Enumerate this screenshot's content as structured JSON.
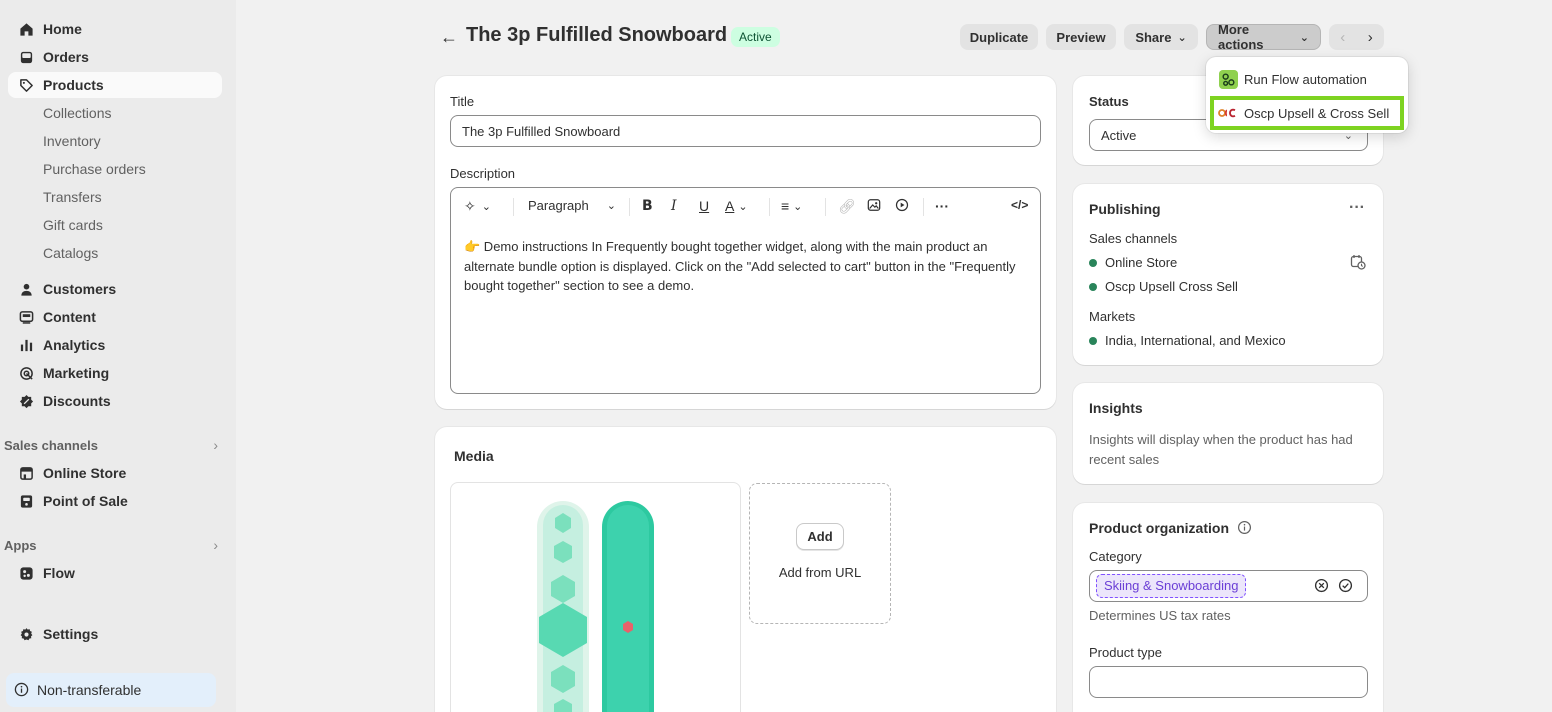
{
  "sidebar": {
    "main_items": [
      {
        "label": "Home",
        "icon": "home-icon"
      },
      {
        "label": "Orders",
        "icon": "orders-icon"
      },
      {
        "label": "Products",
        "icon": "tag-icon"
      }
    ],
    "product_subitems": [
      "Collections",
      "Inventory",
      "Purchase orders",
      "Transfers",
      "Gift cards",
      "Catalogs"
    ],
    "other_items": [
      {
        "label": "Customers",
        "icon": "person-icon"
      },
      {
        "label": "Content",
        "icon": "content-icon"
      },
      {
        "label": "Analytics",
        "icon": "chart-bar-icon"
      },
      {
        "label": "Marketing",
        "icon": "target-icon"
      },
      {
        "label": "Discounts",
        "icon": "discount-icon"
      }
    ],
    "sales_channels_label": "Sales channels",
    "sales_channels": [
      {
        "label": "Online Store",
        "icon": "store-icon"
      },
      {
        "label": "Point of Sale",
        "icon": "pos-icon"
      }
    ],
    "apps_label": "Apps",
    "apps": [
      {
        "label": "Flow",
        "icon": "flow-icon"
      }
    ],
    "settings_label": "Settings",
    "footer_label": "Non-transferable"
  },
  "header": {
    "title": "The 3p Fulfilled Snowboard",
    "status_badge": "Active",
    "buttons": {
      "duplicate": "Duplicate",
      "preview": "Preview",
      "share": "Share",
      "more_actions": "More actions"
    }
  },
  "more_actions_menu": {
    "items": [
      {
        "label": "Run Flow automation",
        "icon": "flow-app-icon"
      },
      {
        "label": "Oscp Upsell & Cross Sell",
        "icon": "oscp-app-icon"
      }
    ]
  },
  "main": {
    "title_label": "Title",
    "title_value": "The 3p Fulfilled Snowboard",
    "description_label": "Description",
    "toolbar": {
      "paragraph": "Paragraph"
    },
    "description_emoji": "👉",
    "description_text": " Demo instructions In Frequently bought together widget, along with the main product an alternate bundle option is displayed. Click on the \"Add selected to cart\" button in the \"Frequently bought together\" section to see a demo.",
    "media_title": "Media",
    "media_add_button": "Add",
    "media_add_from_url": "Add from URL"
  },
  "status_card": {
    "title": "Status",
    "value": "Active"
  },
  "publishing": {
    "title": "Publishing",
    "sales_channels_label": "Sales channels",
    "channels": [
      "Online Store",
      "Oscp Upsell Cross Sell"
    ],
    "markets_label": "Markets",
    "markets": "India, International, and Mexico"
  },
  "insights": {
    "title": "Insights",
    "text": "Insights will display when the product has had recent sales"
  },
  "organization": {
    "title": "Product organization",
    "category_label": "Category",
    "category_value": "Skiing & Snowboarding",
    "category_help": "Determines US tax rates",
    "product_type_label": "Product type",
    "product_type_value": ""
  },
  "colors": {
    "active_badge_bg": "#cdfee1",
    "active_badge_text": "#0c5132",
    "highlight_outline": "#7ed321",
    "published_dot": "#29845a",
    "category_tag": "#6b3fd6"
  }
}
